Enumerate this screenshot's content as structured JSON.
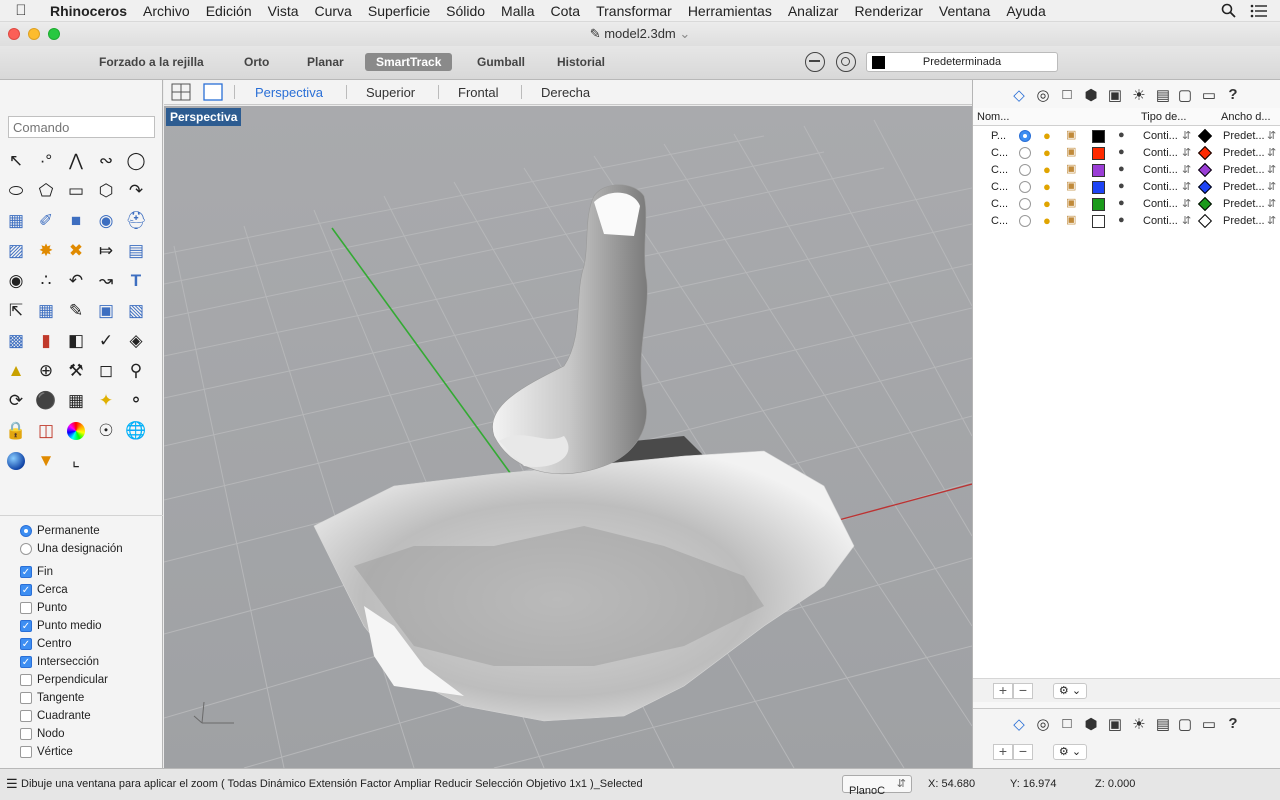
{
  "menubar": {
    "app": "Rhinoceros",
    "items": [
      "Archivo",
      "Edición",
      "Vista",
      "Curva",
      "Superficie",
      "Sólido",
      "Malla",
      "Cota",
      "Transformar",
      "Herramientas",
      "Analizar",
      "Renderizar",
      "Ventana",
      "Ayuda"
    ],
    "icons": [
      "apple-logo",
      "search-icon",
      "list-icon"
    ]
  },
  "window": {
    "title": "model2.3dm"
  },
  "toolbar": {
    "buttons": [
      "Forzado a la rejilla",
      "Orto",
      "Planar",
      "SmartTrack",
      "Gumball",
      "Historial"
    ],
    "active": "SmartTrack",
    "layer": "Predeterminada"
  },
  "viewport_tabs": {
    "tabs": [
      "Perspectiva",
      "Superior",
      "Frontal",
      "Derecha"
    ],
    "active": "Perspectiva"
  },
  "viewport": {
    "label": "Perspectiva",
    "axis_x_color": "#b33",
    "axis_y_color": "#3a3"
  },
  "command": {
    "placeholder": "Comando"
  },
  "osnap": {
    "mode": [
      {
        "label": "Permanente",
        "checked": true
      },
      {
        "label": "Una designación",
        "checked": false
      }
    ],
    "snaps": [
      {
        "label": "Fin",
        "checked": true
      },
      {
        "label": "Cerca",
        "checked": true
      },
      {
        "label": "Punto",
        "checked": false
      },
      {
        "label": "Punto medio",
        "checked": true
      },
      {
        "label": "Centro",
        "checked": true
      },
      {
        "label": "Intersección",
        "checked": true
      },
      {
        "label": "Perpendicular",
        "checked": false
      },
      {
        "label": "Tangente",
        "checked": false
      },
      {
        "label": "Cuadrante",
        "checked": false
      },
      {
        "label": "Nodo",
        "checked": false
      },
      {
        "label": "Vértice",
        "checked": false
      }
    ]
  },
  "layers": {
    "headers": [
      "Nom...",
      "Tipo de...",
      "Ancho d..."
    ],
    "rows": [
      {
        "name": "P...",
        "color": "#000000",
        "linetype": "Conti...",
        "width": "Predet...",
        "current": true
      },
      {
        "name": "C...",
        "color": "#ff2a00",
        "linetype": "Conti...",
        "width": "Predet...",
        "current": false
      },
      {
        "name": "C...",
        "color": "#9b3ed6",
        "linetype": "Conti...",
        "width": "Predet...",
        "current": false
      },
      {
        "name": "C...",
        "color": "#1e44f5",
        "linetype": "Conti...",
        "width": "Predet...",
        "current": false
      },
      {
        "name": "C...",
        "color": "#1a9a1a",
        "linetype": "Conti...",
        "width": "Predet...",
        "current": false
      },
      {
        "name": "C...",
        "color": "#ffffff",
        "linetype": "Conti...",
        "width": "Predet...",
        "current": false
      }
    ]
  },
  "status": {
    "prompt": "Dibuje una ventana para aplicar el zoom ( Todas Dinámico Extensión Factor Ampliar Reducir Selección Objetivo 1x1 )_Selected",
    "plane": "PlanoC",
    "x": "X: 54.680",
    "y": "Y: 16.974",
    "z": "Z: 0.000"
  }
}
